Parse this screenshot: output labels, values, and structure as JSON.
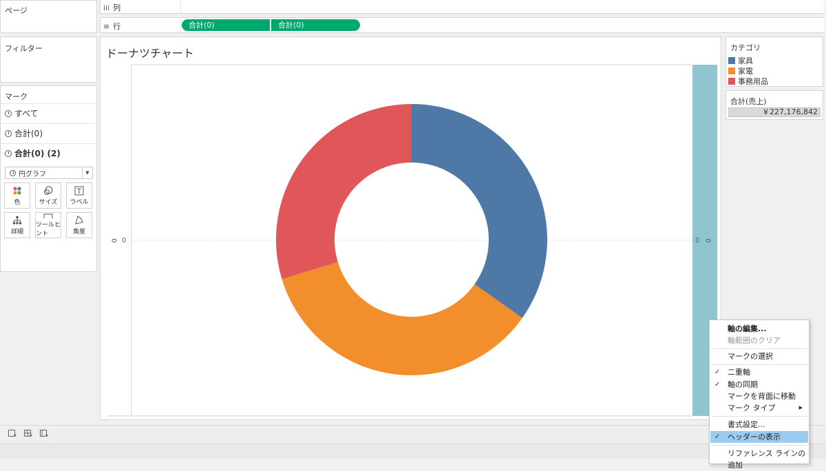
{
  "pages_title": "ページ",
  "columns_shelf": {
    "icon": "iii",
    "label": "列"
  },
  "rows_shelf": {
    "icon": "≡",
    "label": "行",
    "pills": [
      "合計(0)",
      "合計(0)"
    ]
  },
  "filters_title": "フィルター",
  "marks": {
    "title": "マーク",
    "rows": [
      "すべて",
      "合計(0)",
      "合計(0) (2)"
    ],
    "mark_type": "円グラフ",
    "buttons": [
      {
        "label": "色",
        "icon": "color-dots-icon"
      },
      {
        "label": "サイズ",
        "icon": "size-circles-icon"
      },
      {
        "label": "ラベル",
        "icon": "text-label-icon"
      },
      {
        "label": "詳細",
        "icon": "detail-tree-icon"
      },
      {
        "label": "ツールヒント",
        "icon": "tooltip-bubble-icon"
      },
      {
        "label": "角度",
        "icon": "angle-wedge-icon"
      }
    ]
  },
  "view": {
    "title": "ドーナツチャート",
    "left_axis_header": "0",
    "left_axis_tick": "0",
    "right_axis_tick": "0",
    "right_axis_header": "0"
  },
  "legend": {
    "title": "カテゴリ",
    "items": [
      {
        "label": "家具",
        "color": "#4e79a7"
      },
      {
        "label": "家電",
        "color": "#f28e2b"
      },
      {
        "label": "事務用品",
        "color": "#e15759"
      }
    ]
  },
  "total_card": {
    "title": "合計(売上)",
    "value": "￥227,176,842"
  },
  "chart_data": {
    "type": "pie",
    "categories": [
      "家具",
      "家電",
      "事務用品"
    ],
    "values": [
      0.348,
      0.355,
      0.297
    ],
    "colors": [
      "#4e79a7",
      "#f28e2b",
      "#e15759"
    ]
  },
  "context_menu": {
    "items": [
      {
        "label": "軸の編集...",
        "bold": true
      },
      {
        "label": "軸範囲のクリア",
        "disabled": true
      },
      {
        "label": "マークの選択"
      },
      {
        "label": "二重軸",
        "checked": true
      },
      {
        "label": "軸の同期",
        "checked": true
      },
      {
        "label": "マークを背面に移動"
      },
      {
        "label": "マーク タイプ",
        "submenu": true
      },
      {
        "label": "書式設定..."
      },
      {
        "label": "ヘッダーの表示",
        "checked": true,
        "highlighted": true
      },
      {
        "label": "リファレンス ラインの追加"
      }
    ]
  },
  "colors": {
    "pill": "#00a86b",
    "highlight": "#99ccf0",
    "right_band": "#8ec5d1"
  }
}
